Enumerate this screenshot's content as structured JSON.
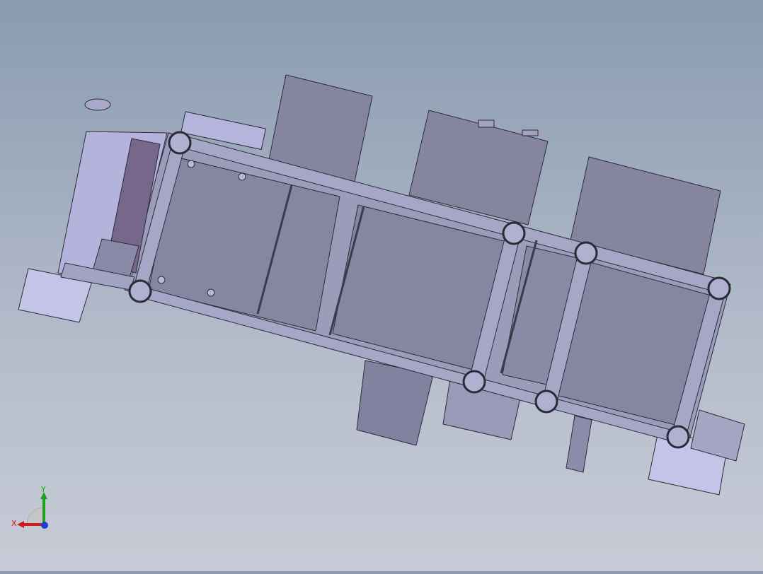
{
  "viewport": {
    "view": "3D CAD model",
    "colors": {
      "part_fill": "#8787a3",
      "part_fill_light": "#a9a9c9",
      "part_fill_pale": "#c8c8ea",
      "frame_fill": "#9e9ebb",
      "edge": "#2b2b38",
      "background_top": "#8a9bb0",
      "background_bottom": "#c7cbd6"
    }
  },
  "triad": {
    "x_label": "X",
    "y_label": "Y",
    "x_color": "#d11a1a",
    "y_color": "#1aa31a",
    "z_color": "#1a3fd1"
  }
}
